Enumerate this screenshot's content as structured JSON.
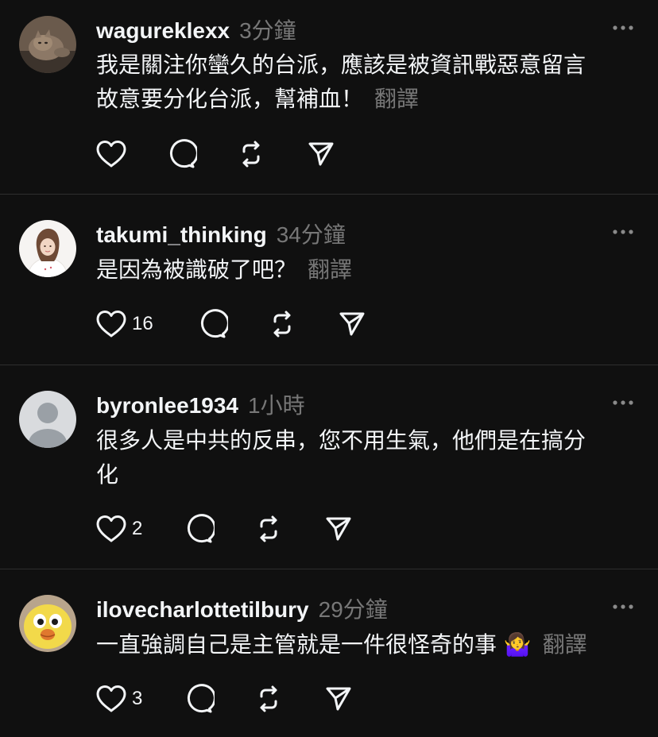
{
  "posts": [
    {
      "username": "wagureklexx",
      "time": "3分鐘",
      "text_lines": [
        "我是關注你蠻久的台派，應該是被資訊戰惡意留言",
        "故意要分化台派，幫補血！"
      ],
      "translate_label": "翻譯",
      "like_count": "",
      "avatar_kind": "cat-photo"
    },
    {
      "username": "takumi_thinking",
      "time": "34分鐘",
      "text_lines": [
        "是因為被識破了吧？"
      ],
      "translate_label": "翻譯",
      "like_count": "16",
      "avatar_kind": "person-photo"
    },
    {
      "username": "byronlee1934",
      "time": "1小時",
      "text_lines": [
        "很多人是中共的反串，您不用生氣，他們是在搞分",
        "化"
      ],
      "translate_label": "",
      "like_count": "2",
      "avatar_kind": "default-avatar"
    },
    {
      "username": "ilovecharlottetilbury",
      "time": "29分鐘",
      "text_lines": [
        "一直強調自己是主管就是一件很怪奇的事 🤷‍♀️"
      ],
      "translate_label": "翻譯",
      "like_count": "3",
      "avatar_kind": "chick-photo"
    }
  ],
  "icons": {
    "like": "heart-icon",
    "reply": "reply-bubble-icon",
    "repost": "repost-icon",
    "share": "send-icon",
    "more": "more-dots-icon"
  },
  "colors": {
    "background": "#101010",
    "text": "#f3f5f7",
    "muted": "#777777",
    "divider": "#2e2e2e"
  }
}
